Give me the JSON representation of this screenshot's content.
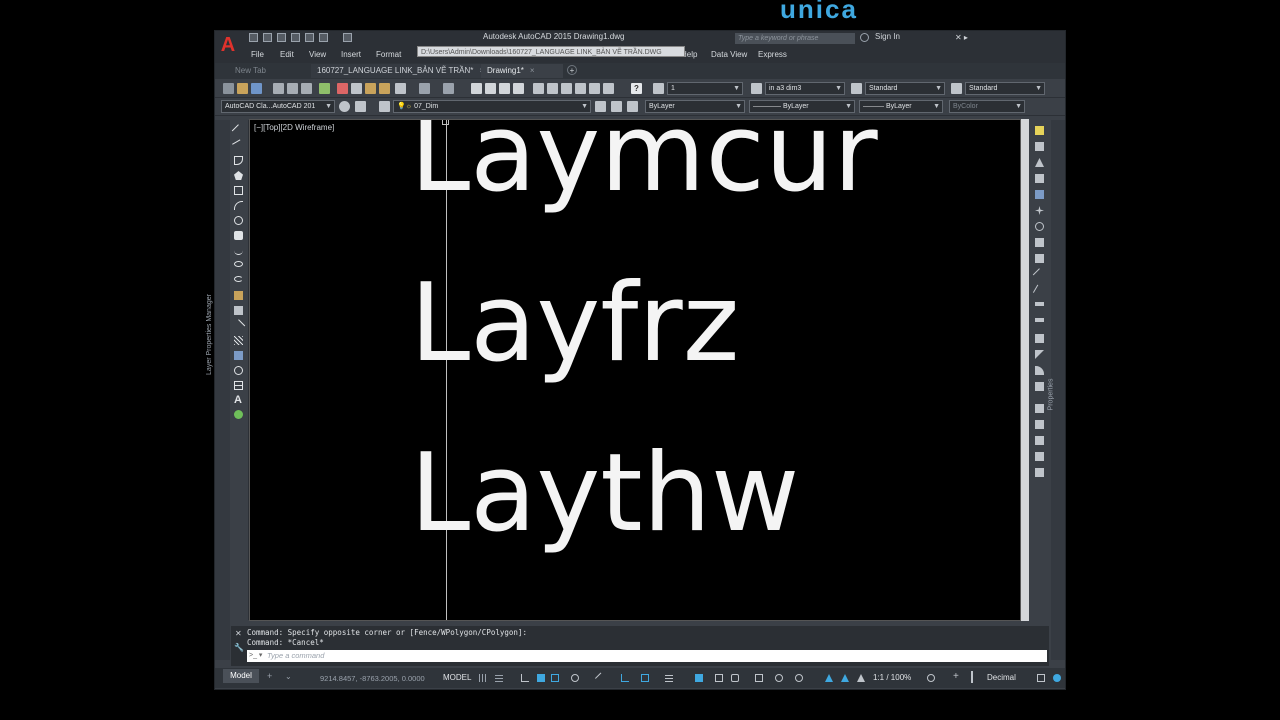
{
  "app": {
    "title": "Autodesk AutoCAD 2015    Drawing1.dwg",
    "logo": "A",
    "search_placeholder": "Type a keyword or phrase",
    "sign_in": "Sign In",
    "watermark": "unica"
  },
  "menu": [
    "File",
    "Edit",
    "View",
    "Insert",
    "Format",
    "Help",
    "Data View",
    "Express"
  ],
  "path_tooltip": "D:\\Users\\Admin\\Downloads\\160727_LANGUAGE LINK_BẢN VẼ TRẦN.DWG",
  "tabs": [
    {
      "label": "New Tab",
      "active": false
    },
    {
      "label": "160727_LANGUAGE LINK_BẢN VẼ TRẦN*",
      "active": false
    },
    {
      "label": "Drawing1*",
      "active": true
    }
  ],
  "toolbar1": {
    "scale_value": "1",
    "dim_style": "in a3 dim3",
    "text_style": "Standard",
    "table_style": "Standard"
  },
  "toolbar2": {
    "workspace": "AutoCAD Cla...AutoCAD 201",
    "layer": "07_Dim",
    "color": "ByLayer",
    "linetype": "ByLayer",
    "lineweight": "ByLayer",
    "plotstyle": "ByColor"
  },
  "left_panel_label": "Layer Properties Manager",
  "right_panel_label": "Properties",
  "canvas": {
    "viewport_label": "[−][Top][2D Wireframe]",
    "lines": [
      "Laymcur",
      "Layfrz",
      "Laythw"
    ]
  },
  "command": {
    "history": [
      "Command: Specify opposite corner or [Fence/WPolygon/CPolygon]:",
      "Command: *Cancel*"
    ],
    "placeholder": "Type a command"
  },
  "status": {
    "model_tab": "Model",
    "coords": "9214.8457, -8763.2005, 0.0000",
    "model": "MODEL",
    "scale": "1:1 / 100%",
    "units": "Decimal"
  },
  "colors": {
    "frame": "#3b4047",
    "canvas": "#000000",
    "accent": "#3fa8e0"
  }
}
